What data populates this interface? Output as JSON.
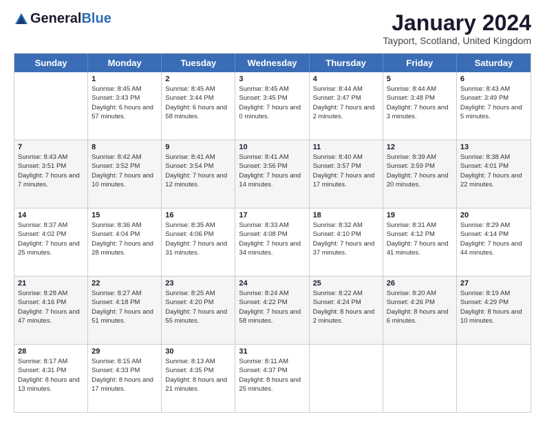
{
  "header": {
    "logo_general": "General",
    "logo_blue": "Blue",
    "month_title": "January 2024",
    "location": "Tayport, Scotland, United Kingdom"
  },
  "day_headers": [
    "Sunday",
    "Monday",
    "Tuesday",
    "Wednesday",
    "Thursday",
    "Friday",
    "Saturday"
  ],
  "weeks": [
    [
      {
        "day": "",
        "sunrise": "",
        "sunset": "",
        "daylight": "",
        "empty": true
      },
      {
        "day": "1",
        "sunrise": "Sunrise: 8:45 AM",
        "sunset": "Sunset: 3:43 PM",
        "daylight": "Daylight: 6 hours and 57 minutes."
      },
      {
        "day": "2",
        "sunrise": "Sunrise: 8:45 AM",
        "sunset": "Sunset: 3:44 PM",
        "daylight": "Daylight: 6 hours and 58 minutes."
      },
      {
        "day": "3",
        "sunrise": "Sunrise: 8:45 AM",
        "sunset": "Sunset: 3:45 PM",
        "daylight": "Daylight: 7 hours and 0 minutes."
      },
      {
        "day": "4",
        "sunrise": "Sunrise: 8:44 AM",
        "sunset": "Sunset: 3:47 PM",
        "daylight": "Daylight: 7 hours and 2 minutes."
      },
      {
        "day": "5",
        "sunrise": "Sunrise: 8:44 AM",
        "sunset": "Sunset: 3:48 PM",
        "daylight": "Daylight: 7 hours and 3 minutes."
      },
      {
        "day": "6",
        "sunrise": "Sunrise: 8:43 AM",
        "sunset": "Sunset: 3:49 PM",
        "daylight": "Daylight: 7 hours and 5 minutes."
      }
    ],
    [
      {
        "day": "7",
        "sunrise": "Sunrise: 8:43 AM",
        "sunset": "Sunset: 3:51 PM",
        "daylight": "Daylight: 7 hours and 7 minutes."
      },
      {
        "day": "8",
        "sunrise": "Sunrise: 8:42 AM",
        "sunset": "Sunset: 3:52 PM",
        "daylight": "Daylight: 7 hours and 10 minutes."
      },
      {
        "day": "9",
        "sunrise": "Sunrise: 8:41 AM",
        "sunset": "Sunset: 3:54 PM",
        "daylight": "Daylight: 7 hours and 12 minutes."
      },
      {
        "day": "10",
        "sunrise": "Sunrise: 8:41 AM",
        "sunset": "Sunset: 3:56 PM",
        "daylight": "Daylight: 7 hours and 14 minutes."
      },
      {
        "day": "11",
        "sunrise": "Sunrise: 8:40 AM",
        "sunset": "Sunset: 3:57 PM",
        "daylight": "Daylight: 7 hours and 17 minutes."
      },
      {
        "day": "12",
        "sunrise": "Sunrise: 8:39 AM",
        "sunset": "Sunset: 3:59 PM",
        "daylight": "Daylight: 7 hours and 20 minutes."
      },
      {
        "day": "13",
        "sunrise": "Sunrise: 8:38 AM",
        "sunset": "Sunset: 4:01 PM",
        "daylight": "Daylight: 7 hours and 22 minutes."
      }
    ],
    [
      {
        "day": "14",
        "sunrise": "Sunrise: 8:37 AM",
        "sunset": "Sunset: 4:02 PM",
        "daylight": "Daylight: 7 hours and 25 minutes."
      },
      {
        "day": "15",
        "sunrise": "Sunrise: 8:36 AM",
        "sunset": "Sunset: 4:04 PM",
        "daylight": "Daylight: 7 hours and 28 minutes."
      },
      {
        "day": "16",
        "sunrise": "Sunrise: 8:35 AM",
        "sunset": "Sunset: 4:06 PM",
        "daylight": "Daylight: 7 hours and 31 minutes."
      },
      {
        "day": "17",
        "sunrise": "Sunrise: 8:33 AM",
        "sunset": "Sunset: 4:08 PM",
        "daylight": "Daylight: 7 hours and 34 minutes."
      },
      {
        "day": "18",
        "sunrise": "Sunrise: 8:32 AM",
        "sunset": "Sunset: 4:10 PM",
        "daylight": "Daylight: 7 hours and 37 minutes."
      },
      {
        "day": "19",
        "sunrise": "Sunrise: 8:31 AM",
        "sunset": "Sunset: 4:12 PM",
        "daylight": "Daylight: 7 hours and 41 minutes."
      },
      {
        "day": "20",
        "sunrise": "Sunrise: 8:29 AM",
        "sunset": "Sunset: 4:14 PM",
        "daylight": "Daylight: 7 hours and 44 minutes."
      }
    ],
    [
      {
        "day": "21",
        "sunrise": "Sunrise: 8:28 AM",
        "sunset": "Sunset: 4:16 PM",
        "daylight": "Daylight: 7 hours and 47 minutes."
      },
      {
        "day": "22",
        "sunrise": "Sunrise: 8:27 AM",
        "sunset": "Sunset: 4:18 PM",
        "daylight": "Daylight: 7 hours and 51 minutes."
      },
      {
        "day": "23",
        "sunrise": "Sunrise: 8:25 AM",
        "sunset": "Sunset: 4:20 PM",
        "daylight": "Daylight: 7 hours and 55 minutes."
      },
      {
        "day": "24",
        "sunrise": "Sunrise: 8:24 AM",
        "sunset": "Sunset: 4:22 PM",
        "daylight": "Daylight: 7 hours and 58 minutes."
      },
      {
        "day": "25",
        "sunrise": "Sunrise: 8:22 AM",
        "sunset": "Sunset: 4:24 PM",
        "daylight": "Daylight: 8 hours and 2 minutes."
      },
      {
        "day": "26",
        "sunrise": "Sunrise: 8:20 AM",
        "sunset": "Sunset: 4:26 PM",
        "daylight": "Daylight: 8 hours and 6 minutes."
      },
      {
        "day": "27",
        "sunrise": "Sunrise: 8:19 AM",
        "sunset": "Sunset: 4:29 PM",
        "daylight": "Daylight: 8 hours and 10 minutes."
      }
    ],
    [
      {
        "day": "28",
        "sunrise": "Sunrise: 8:17 AM",
        "sunset": "Sunset: 4:31 PM",
        "daylight": "Daylight: 8 hours and 13 minutes."
      },
      {
        "day": "29",
        "sunrise": "Sunrise: 8:15 AM",
        "sunset": "Sunset: 4:33 PM",
        "daylight": "Daylight: 8 hours and 17 minutes."
      },
      {
        "day": "30",
        "sunrise": "Sunrise: 8:13 AM",
        "sunset": "Sunset: 4:35 PM",
        "daylight": "Daylight: 8 hours and 21 minutes."
      },
      {
        "day": "31",
        "sunrise": "Sunrise: 8:11 AM",
        "sunset": "Sunset: 4:37 PM",
        "daylight": "Daylight: 8 hours and 25 minutes."
      },
      {
        "day": "",
        "empty": true
      },
      {
        "day": "",
        "empty": true
      },
      {
        "day": "",
        "empty": true
      }
    ]
  ]
}
